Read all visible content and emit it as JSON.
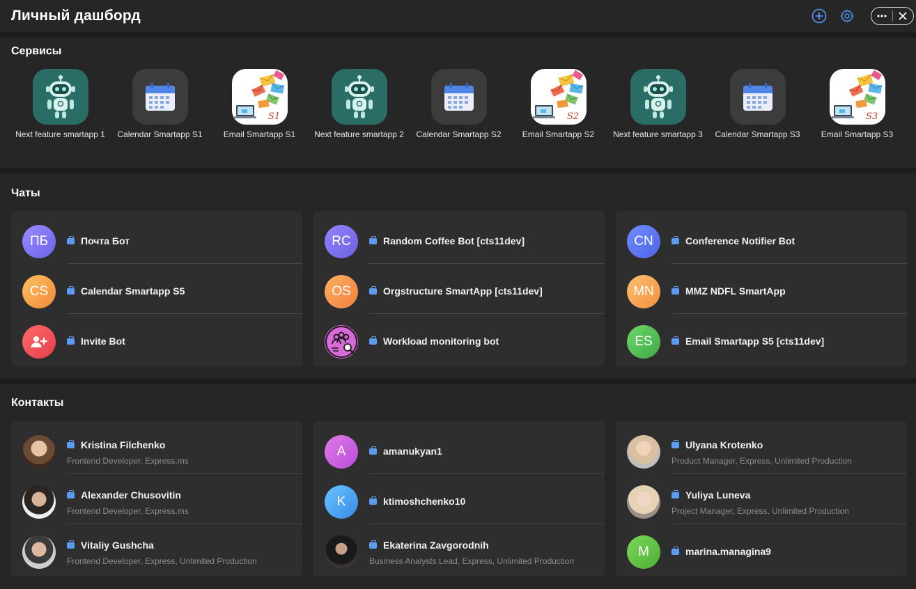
{
  "header": {
    "title": "Личный дашборд"
  },
  "services": {
    "title": "Сервисы",
    "items": [
      {
        "label": "Next feature smartapp 1",
        "icon": "robot-icon"
      },
      {
        "label": "Calendar Smartapp S1",
        "icon": "calendar-icon"
      },
      {
        "label": "Email Smartapp S1",
        "icon": "email-icon",
        "tag": "S1"
      },
      {
        "label": "Next feature smartapp 2",
        "icon": "robot-icon"
      },
      {
        "label": "Calendar Smartapp S2",
        "icon": "calendar-icon"
      },
      {
        "label": "Email Smartapp S2",
        "icon": "email-icon",
        "tag": "S2"
      },
      {
        "label": "Next feature smartapp 3",
        "icon": "robot-icon"
      },
      {
        "label": "Calendar Smartapp S3",
        "icon": "calendar-icon"
      },
      {
        "label": "Email Smartapp S3",
        "icon": "email-icon",
        "tag": "S3"
      }
    ]
  },
  "chats": {
    "title": "Чаты",
    "columns": [
      [
        {
          "initials": "ПБ",
          "name": "Почта Бот"
        },
        {
          "initials": "CS",
          "name": "Calendar Smartapp S5"
        },
        {
          "initials": "",
          "name": "Invite Bot"
        }
      ],
      [
        {
          "initials": "RC",
          "name": "Random Coffee Bot [cts11dev]"
        },
        {
          "initials": "OS",
          "name": "Orgstructure SmartApp [cts11dev]"
        },
        {
          "initials": "",
          "name": "Workload monitoring bot"
        }
      ],
      [
        {
          "initials": "CN",
          "name": "Conference Notifier Bot"
        },
        {
          "initials": "MN",
          "name": "MMZ NDFL SmartApp"
        },
        {
          "initials": "ES",
          "name": "Email Smartapp S5 [cts11dev]"
        }
      ]
    ]
  },
  "contacts": {
    "title": "Контакты",
    "columns": [
      [
        {
          "name": "Kristina Filchenko",
          "subtitle": "Frontend Developer, Express.ms"
        },
        {
          "name": "Alexander Chusovitin",
          "subtitle": "Frontend Developer, Express.ms"
        },
        {
          "name": "Vitaliy Gushcha",
          "subtitle": "Frontend Developer, Express, Unlimited Production"
        }
      ],
      [
        {
          "initials": "A",
          "name": "amanukyan1"
        },
        {
          "initials": "K",
          "name": "ktimoshchenko10"
        },
        {
          "name": "Ekaterina Zavgorodnih",
          "subtitle": "Business Analysts Lead, Express, Unlimited Production"
        }
      ],
      [
        {
          "name": "Ulyana Krotenko",
          "subtitle": "Product Manager, Express, Unlimited Production"
        },
        {
          "name": "Yuliya Luneva",
          "subtitle": "Project Manager, Express, Unlimited Production"
        },
        {
          "initials": "M",
          "name": "marina.managina9"
        }
      ]
    ]
  }
}
